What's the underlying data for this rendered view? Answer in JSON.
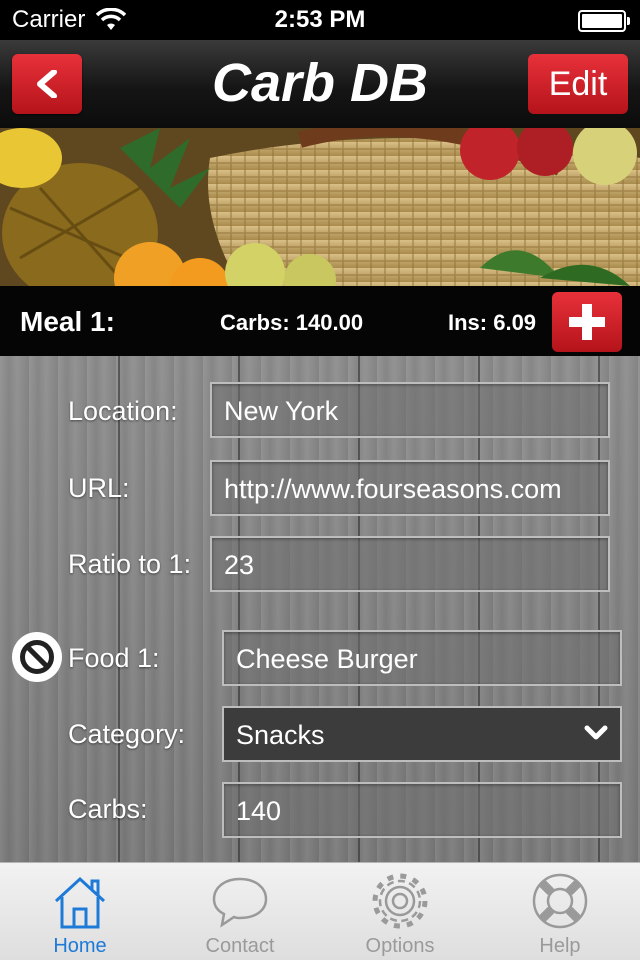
{
  "status_bar": {
    "carrier": "Carrier",
    "time": "2:53 PM"
  },
  "nav": {
    "title": "Carb DB",
    "back_icon": "chevron-left-icon",
    "edit_label": "Edit"
  },
  "meal": {
    "label": "Meal 1:",
    "carbs_text": "Carbs: 140.00",
    "ins_text": "Ins: 6.09",
    "add_icon": "plus-icon"
  },
  "form": {
    "location_label": "Location:",
    "location_value": "New York",
    "url_label": "URL:",
    "url_value": "http://www.fourseasons.com",
    "ratio_label": "Ratio to 1:",
    "ratio_value": "23",
    "food_label": "Food 1:",
    "food_value": "Cheese Burger",
    "category_label": "Category:",
    "category_value": "Snacks",
    "carbs_label": "Carbs:",
    "carbs_value": "140"
  },
  "tabs": [
    {
      "label": "Home",
      "icon": "home-icon",
      "active": true
    },
    {
      "label": "Contact",
      "icon": "speech-bubble-icon",
      "active": false
    },
    {
      "label": "Options",
      "icon": "gear-icon",
      "active": false
    },
    {
      "label": "Help",
      "icon": "lifebuoy-icon",
      "active": false
    }
  ],
  "colors": {
    "accent_red": "#d6222a",
    "active_tab_blue": "#1e7ad8",
    "inactive_tab_gray": "#9a9a9a"
  }
}
